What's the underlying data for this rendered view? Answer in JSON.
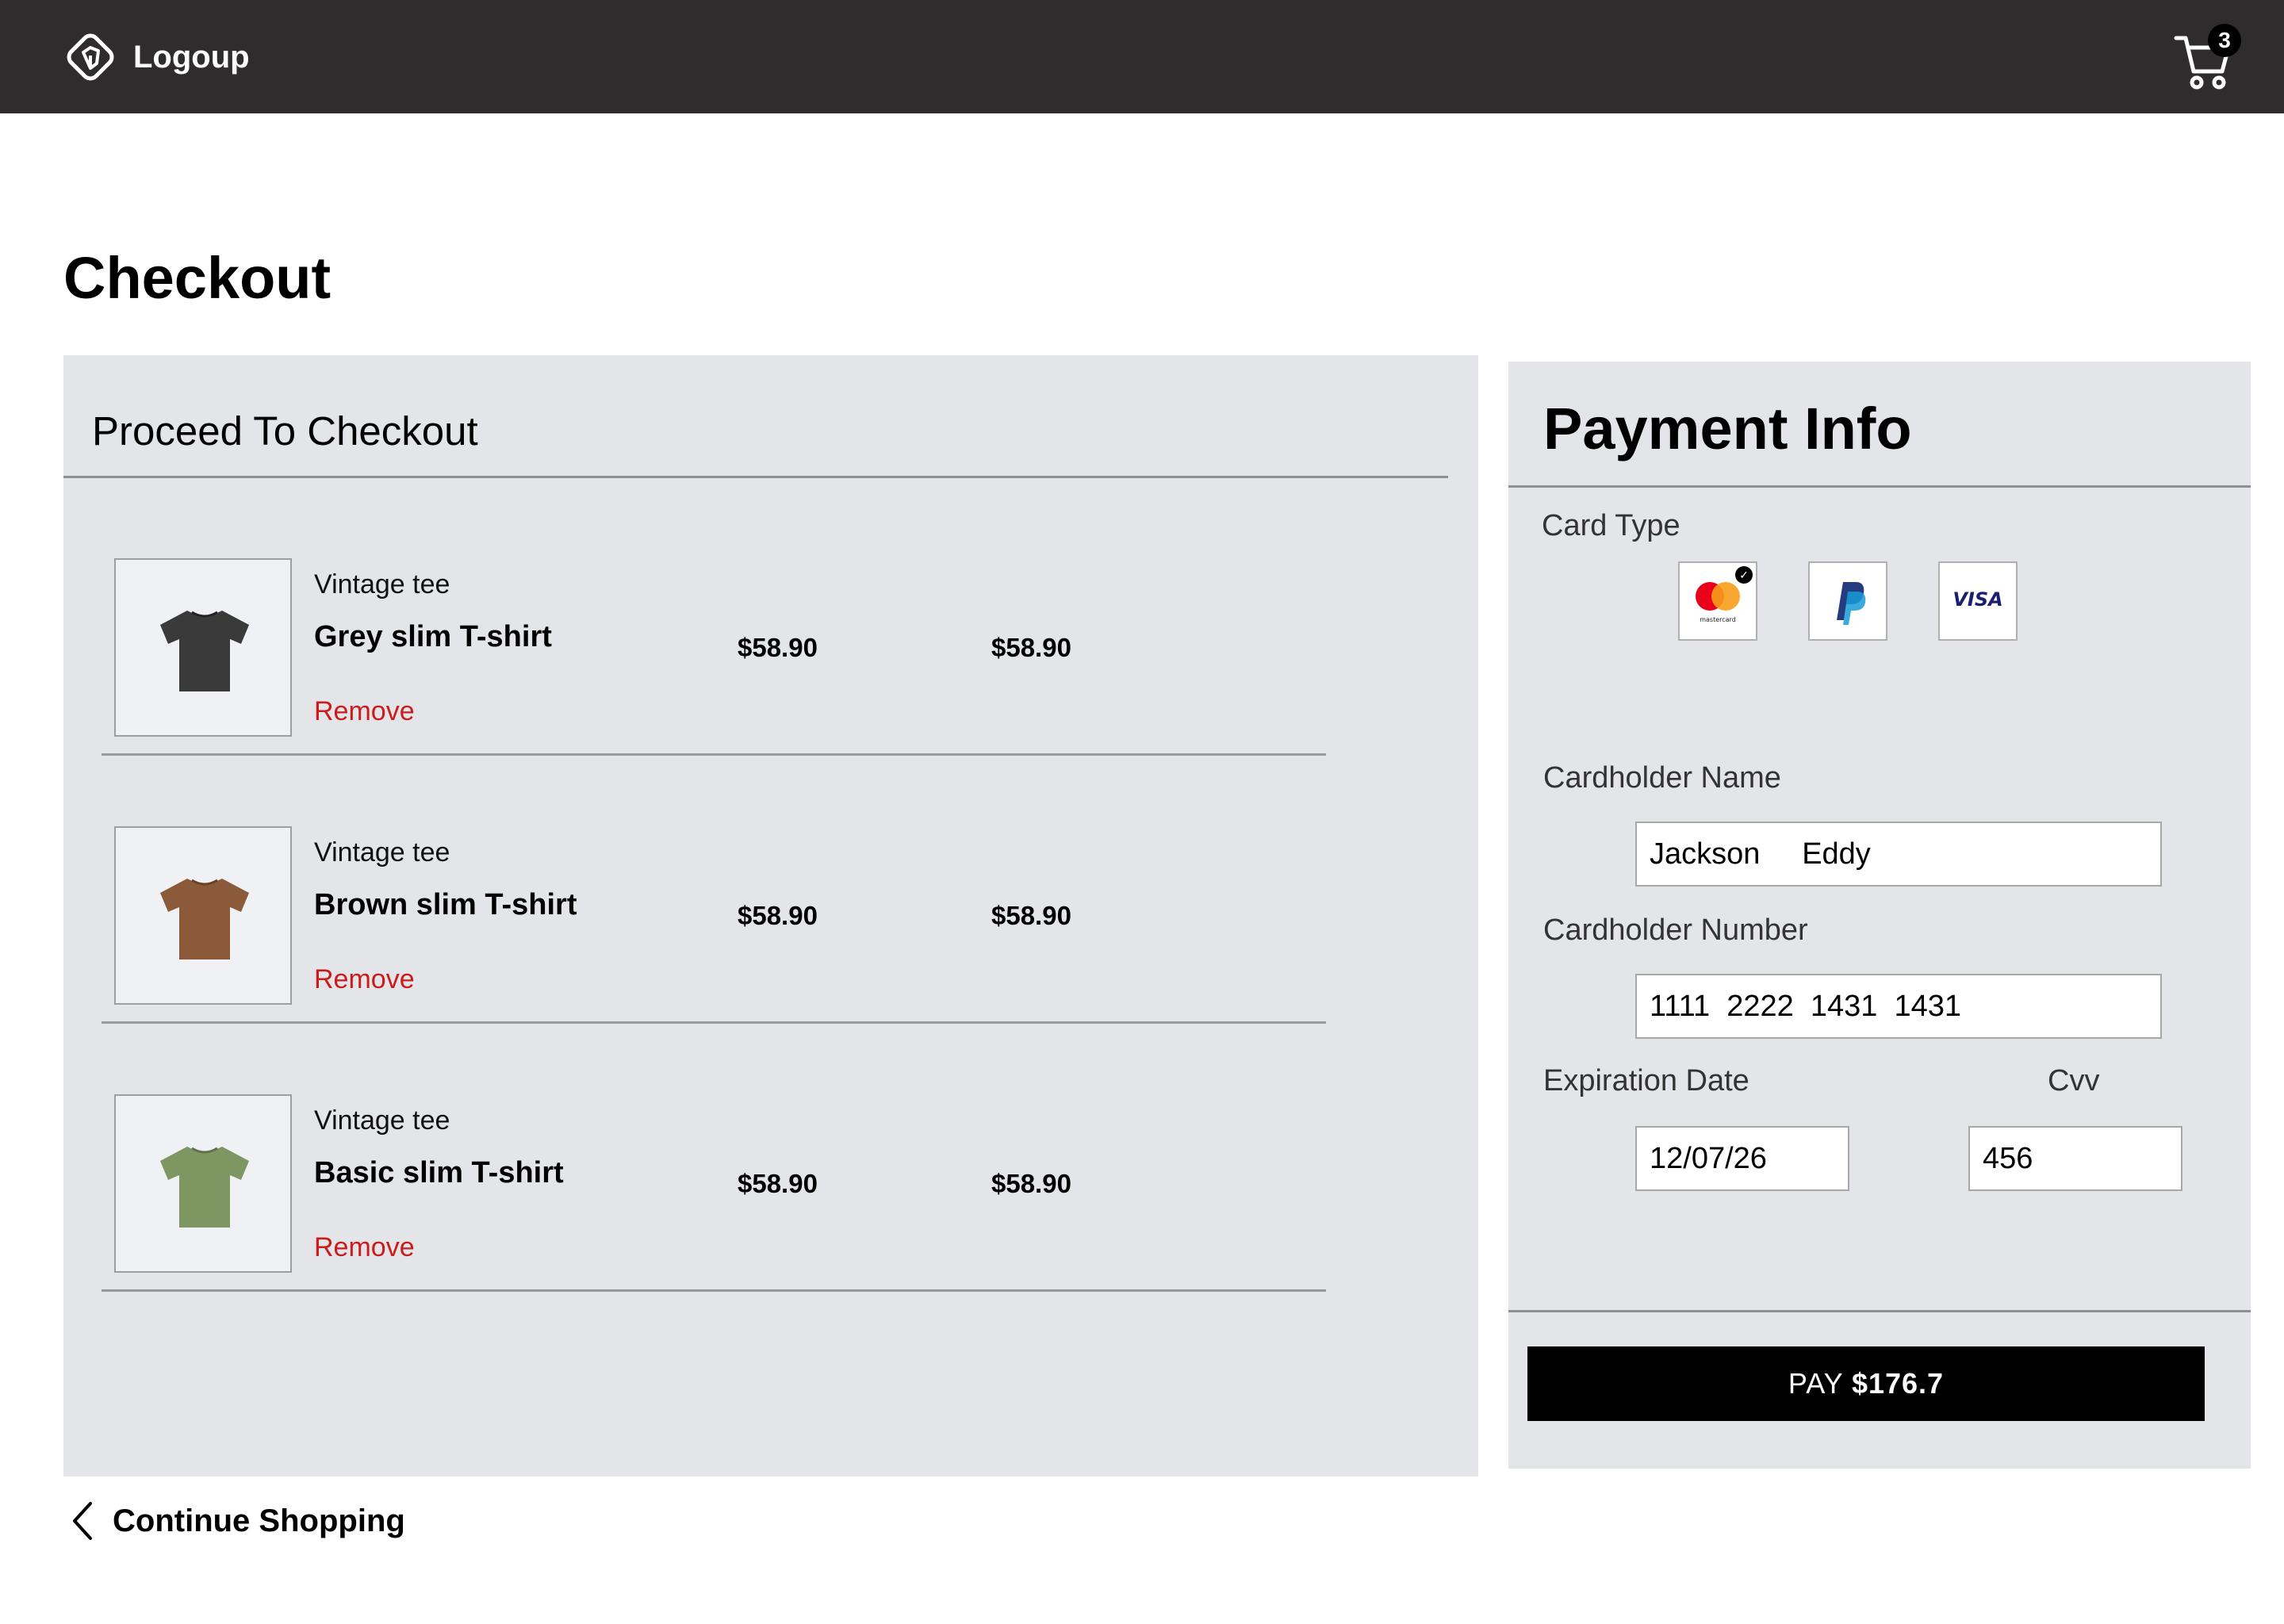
{
  "header": {
    "logo_text": "Logoup",
    "cart_count": "3"
  },
  "page_title": "Checkout",
  "checkout": {
    "panel_title": "Proceed To Checkout",
    "items": [
      {
        "subtitle": "Vintage tee",
        "name": "Grey slim T-shirt",
        "price": "$58.90",
        "total": "$58.90",
        "remove_label": "Remove",
        "color": "#3a3a3a"
      },
      {
        "subtitle": "Vintage tee",
        "name": "Brown slim T-shirt",
        "price": "$58.90",
        "total": "$58.90",
        "remove_label": "Remove",
        "color": "#8a5a3a"
      },
      {
        "subtitle": "Vintage tee",
        "name": "Basic slim T-shirt",
        "price": "$58.90",
        "total": "$58.90",
        "remove_label": "Remove",
        "color": "#7e9662"
      }
    ],
    "continue_label": "Continue Shopping"
  },
  "payment": {
    "title": "Payment Info",
    "card_type_label": "Card Type",
    "card_types": [
      {
        "name": "mastercard",
        "selected": true,
        "text": "mastercard"
      },
      {
        "name": "paypal",
        "selected": false
      },
      {
        "name": "visa",
        "selected": false,
        "text": "VISA"
      }
    ],
    "cardholder_name_label": "Cardholder Name",
    "cardholder_name_value": "Jackson     Eddy",
    "cardholder_number_label": "Cardholder Number",
    "cardholder_number_value": "1111  2222  1431  1431",
    "expiration_label": "Expiration Date",
    "expiration_value": "12/07/26",
    "cvv_label": "Cvv",
    "cvv_value": "456",
    "pay_prefix": "PAY ",
    "pay_amount": "$176.7"
  },
  "colors": {
    "topbar": "#2e2c2d",
    "panel": "#e4e5e9",
    "remove": "#cc1b1b",
    "pay_button": "#000000"
  }
}
